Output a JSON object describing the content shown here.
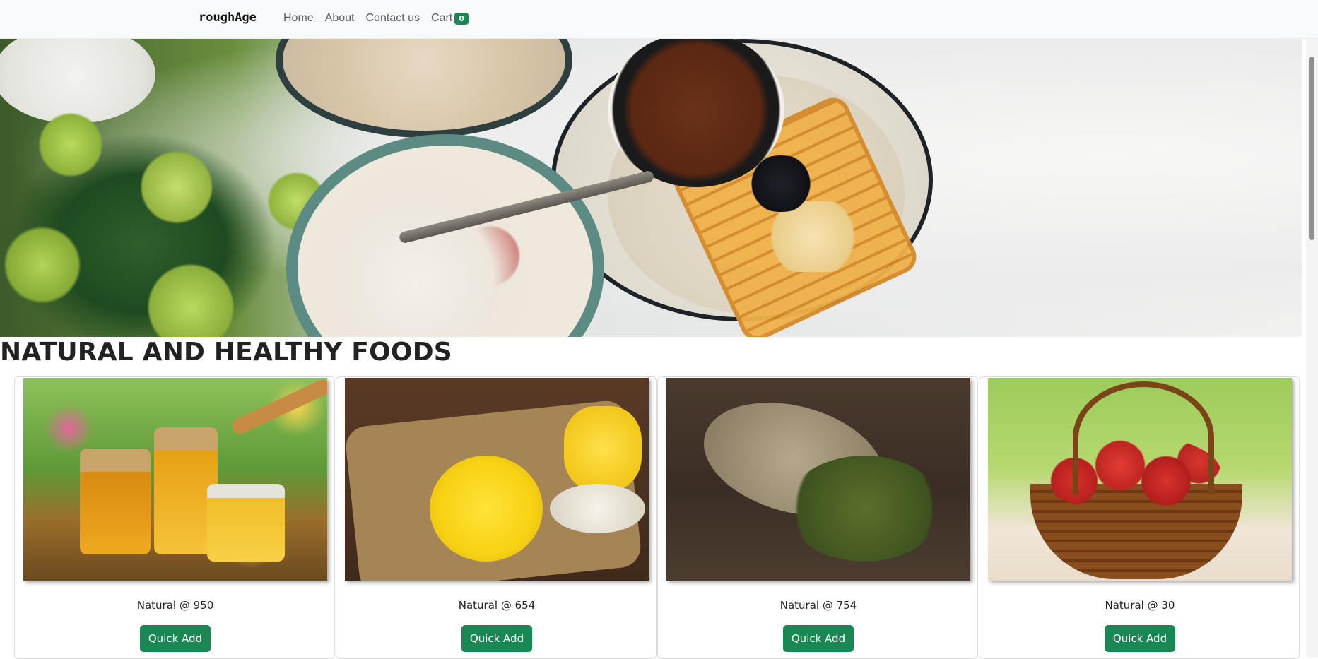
{
  "navbar": {
    "brand": "roughAge",
    "links": [
      "Home",
      "About",
      "Contact us"
    ],
    "cart_label": "Cart",
    "cart_count": "0"
  },
  "hero": {
    "image": "breakfast-table-photo"
  },
  "section": {
    "heading": "NATURAL AND HEALTHY FOODS"
  },
  "products": [
    {
      "title": "Natural @ 950",
      "button": "Quick Add",
      "image": "honey-jars-photo"
    },
    {
      "title": "Natural @ 654",
      "button": "Quick Add",
      "image": "ghee-jar-photo"
    },
    {
      "title": "Natural @ 754",
      "button": "Quick Add",
      "image": "mung-beans-sack-photo"
    },
    {
      "title": "Natural @ 30",
      "button": "Quick Add",
      "image": "apple-basket-photo"
    }
  ],
  "colors": {
    "accent": "#198754",
    "navbar_bg": "#f8f9fa"
  }
}
